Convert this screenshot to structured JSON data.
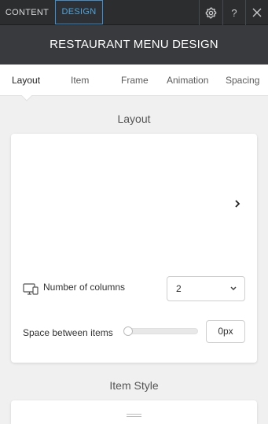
{
  "topbar": {
    "tabs": [
      "CONTENT",
      "DESIGN"
    ],
    "active_tab": "DESIGN",
    "help_label": "?",
    "icons": [
      "gear-icon",
      "help-icon",
      "close-icon"
    ]
  },
  "header": {
    "title": "RESTAURANT MENU DESIGN"
  },
  "subtabs": {
    "items": [
      "Layout",
      "Item",
      "Frame",
      "Animation",
      "Spacing"
    ],
    "active": "Layout"
  },
  "layout_section": {
    "title": "Layout",
    "columns_label": "Number of columns",
    "columns_value": "2",
    "spacing_label": "Space between items",
    "spacing_value": "0px",
    "spacing_slider_level": 0
  },
  "item_style_section": {
    "title": "Item Style"
  },
  "colors": {
    "accent": "#3d8fd0",
    "topbar_bg": "#2b2d2f",
    "header_bg": "#383a3d"
  }
}
